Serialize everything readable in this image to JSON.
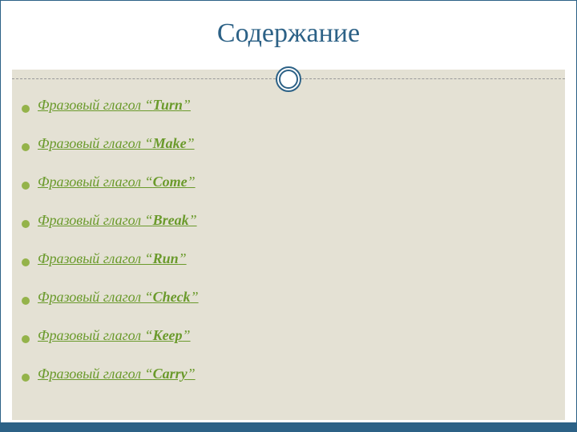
{
  "title": "Содержание",
  "items": [
    {
      "prefix": "Фразовый глагол “",
      "word": "Turn",
      "suffix": "”"
    },
    {
      "prefix": "Фразовый глагол “",
      "word": "Make",
      "suffix": "”"
    },
    {
      "prefix": "Фразовый глагол “",
      "word": "Come",
      "suffix": "”"
    },
    {
      "prefix": "Фразовый глагол “",
      "word": "Break",
      "suffix": "”"
    },
    {
      "prefix": "Фразовый глагол “",
      "word": "Run",
      "suffix": "”"
    },
    {
      "prefix": "Фразовый глагол “",
      "word": "Check",
      "suffix": "”"
    },
    {
      "prefix": "Фразовый глагол “",
      "word": "Keep",
      "suffix": "”"
    },
    {
      "prefix": "Фразовый глагол “",
      "word": "Carry",
      "suffix": "”"
    }
  ]
}
